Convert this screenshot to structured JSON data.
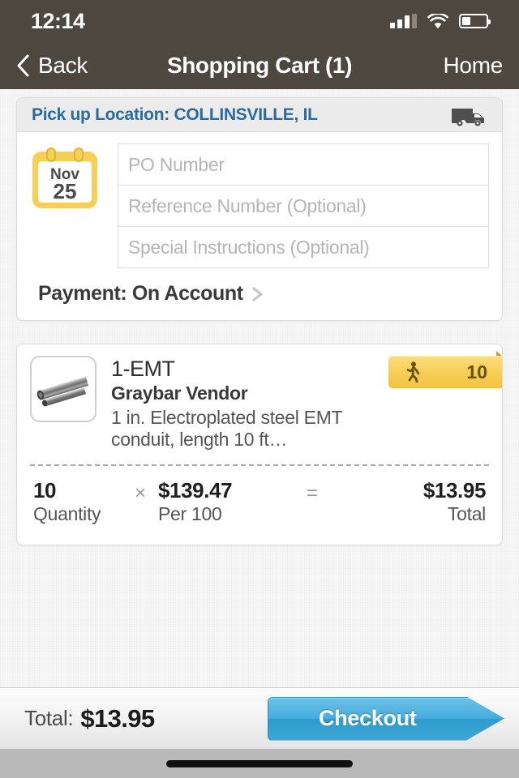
{
  "statusbar": {
    "time": "12:14",
    "signal_icon": "cellular-signal-icon",
    "wifi_icon": "wifi-icon",
    "battery_icon": "battery-icon",
    "battery_level_percent": 30
  },
  "navbar": {
    "back_label": "Back",
    "back_icon": "chevron-left-icon",
    "title": "Shopping Cart (1)",
    "home_label": "Home"
  },
  "pickup": {
    "header_label": "Pick up Location: COLLINSVILLE, IL",
    "truck_icon": "delivery-truck-icon",
    "calendar": {
      "month": "Nov",
      "day": "25"
    },
    "fields": [
      {
        "name": "po-number",
        "value": "",
        "placeholder": "PO Number"
      },
      {
        "name": "reference-number",
        "value": "",
        "placeholder": "Reference Number (Optional)"
      },
      {
        "name": "special-instructions",
        "value": "",
        "placeholder": "Special Instructions (Optional)"
      }
    ],
    "payment_label": "Payment: On Account",
    "payment_chevron_icon": "chevron-right-icon"
  },
  "product": {
    "thumbnail_icon": "emt-conduit-pipe-image",
    "title": "1-EMT",
    "vendor": "Graybar Vendor",
    "description": "1 in. Electroplated steel EMT conduit, length 10 ft…",
    "stock_badge": {
      "icon": "walking-person-icon",
      "count": "10"
    },
    "pricing": {
      "quantity_value": "10",
      "quantity_label": "Quantity",
      "multiply_symbol": "×",
      "unit_price_value": "$139.47",
      "unit_price_label": "Per 100",
      "equals_symbol": "=",
      "total_value": "$13.95",
      "total_label": "Total"
    }
  },
  "bottombar": {
    "total_label": "Total:",
    "total_value": "$13.95",
    "checkout_label": "Checkout"
  },
  "colors": {
    "navbar": "#4e4740",
    "accent_blue": "#2a6b9e",
    "checkout_blue": "#3fa7d6",
    "badge_gold": "#f7cf58",
    "page_bg": "#f6f6f6"
  }
}
